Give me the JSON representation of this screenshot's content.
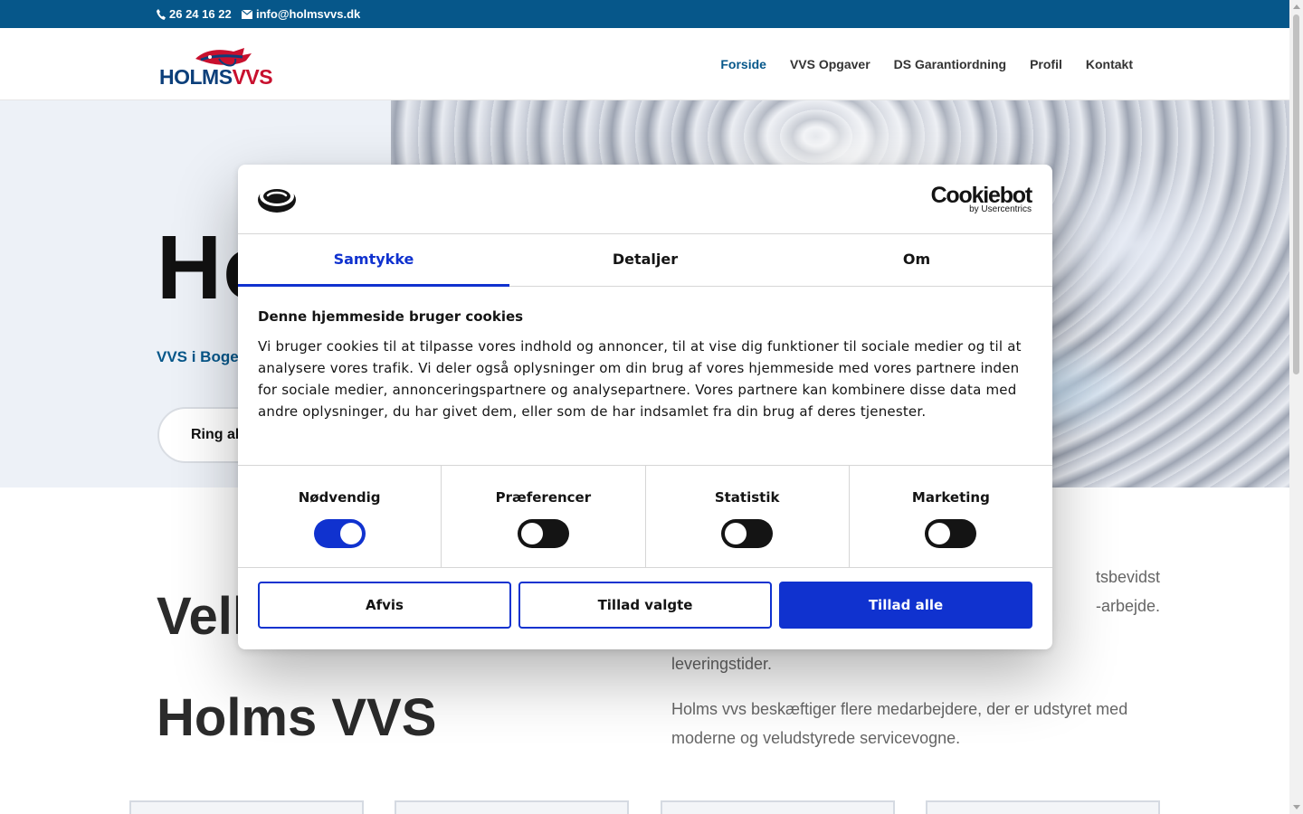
{
  "topbar": {
    "phone": "26 24 16 22",
    "email": "info@holmsvvs.dk"
  },
  "logo": {
    "word1": "HOLMS",
    "word2": "VVS"
  },
  "nav": [
    {
      "label": "Forside",
      "active": true
    },
    {
      "label": "VVS Opgaver"
    },
    {
      "label": "DS Garantiordning"
    },
    {
      "label": "Profil"
    },
    {
      "label": "Kontakt"
    }
  ],
  "hero": {
    "title": "Ho",
    "subtitle": "VVS i Boge",
    "cta": "Ring al"
  },
  "intro": {
    "title_line1": "Vell",
    "title_line2": "Holms VVS",
    "frag_line1": "tsbevidst",
    "frag_line2": "-arbejde.",
    "frag_line3": "leveringstider.",
    "para2": "Holms vvs beskæftiger flere medarbejdere, der er udstyret med moderne og veludstyrede servicevogne."
  },
  "cookie": {
    "brand": "Cookiebot",
    "brand_sub": "by Usercentrics",
    "tabs": [
      "Samtykke",
      "Detaljer",
      "Om"
    ],
    "heading": "Denne hjemmeside bruger cookies",
    "body": "Vi bruger cookies til at tilpasse vores indhold og annoncer, til at vise dig funktioner til sociale medier og til at analysere vores trafik. Vi deler også oplysninger om din brug af vores hjemmeside med vores partnere inden for sociale medier, annonceringspartnere og analysepartnere. Vores partnere kan kombinere disse data med andre oplysninger, du har givet dem, eller som de har indsamlet fra din brug af deres tjenester.",
    "toggles": [
      {
        "label": "Nødvendig",
        "on": true
      },
      {
        "label": "Præferencer",
        "on": false
      },
      {
        "label": "Statistik",
        "on": false
      },
      {
        "label": "Marketing",
        "on": false
      }
    ],
    "buttons": {
      "reject": "Afvis",
      "allow_selected": "Tillad valgte",
      "allow_all": "Tillad alle"
    },
    "accent": "#1032cf"
  },
  "colors": {
    "brand_blue": "#06578a",
    "logo_red": "#c8102e"
  }
}
